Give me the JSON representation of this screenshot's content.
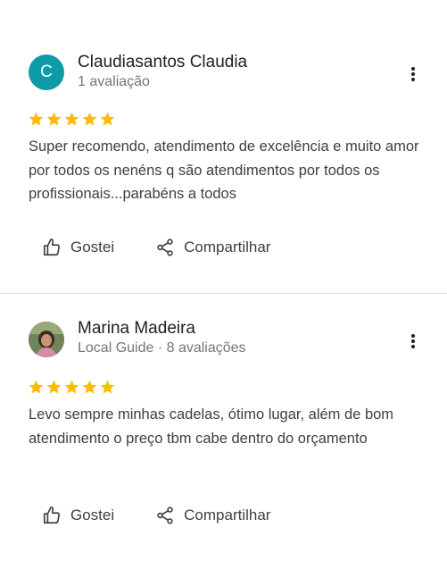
{
  "colors": {
    "star": "#fbbc04",
    "avatar_bg": "#0f9aa8",
    "divider": "#e0e0e0",
    "meta_text": "#70757a"
  },
  "reviews": [
    {
      "avatar_letter": "C",
      "author": "Claudiasantos Claudia",
      "meta": "1 avaliação",
      "rating": 5,
      "text": "Super recomendo, atendimento de excelência e muito amor por todos os nenéns q são atendimentos por todos os profissionais...parabéns a todos",
      "like_label": "Gostei",
      "share_label": "Compartilhar"
    },
    {
      "avatar_letter": "",
      "author": "Marina Madeira",
      "meta": "Local Guide · 8 avaliações",
      "rating": 5,
      "text": "Levo sempre minhas cadelas, ótimo lugar, além de bom atendimento o preço tbm cabe dentro do orçamento",
      "like_label": "Gostei",
      "share_label": "Compartilhar"
    }
  ]
}
